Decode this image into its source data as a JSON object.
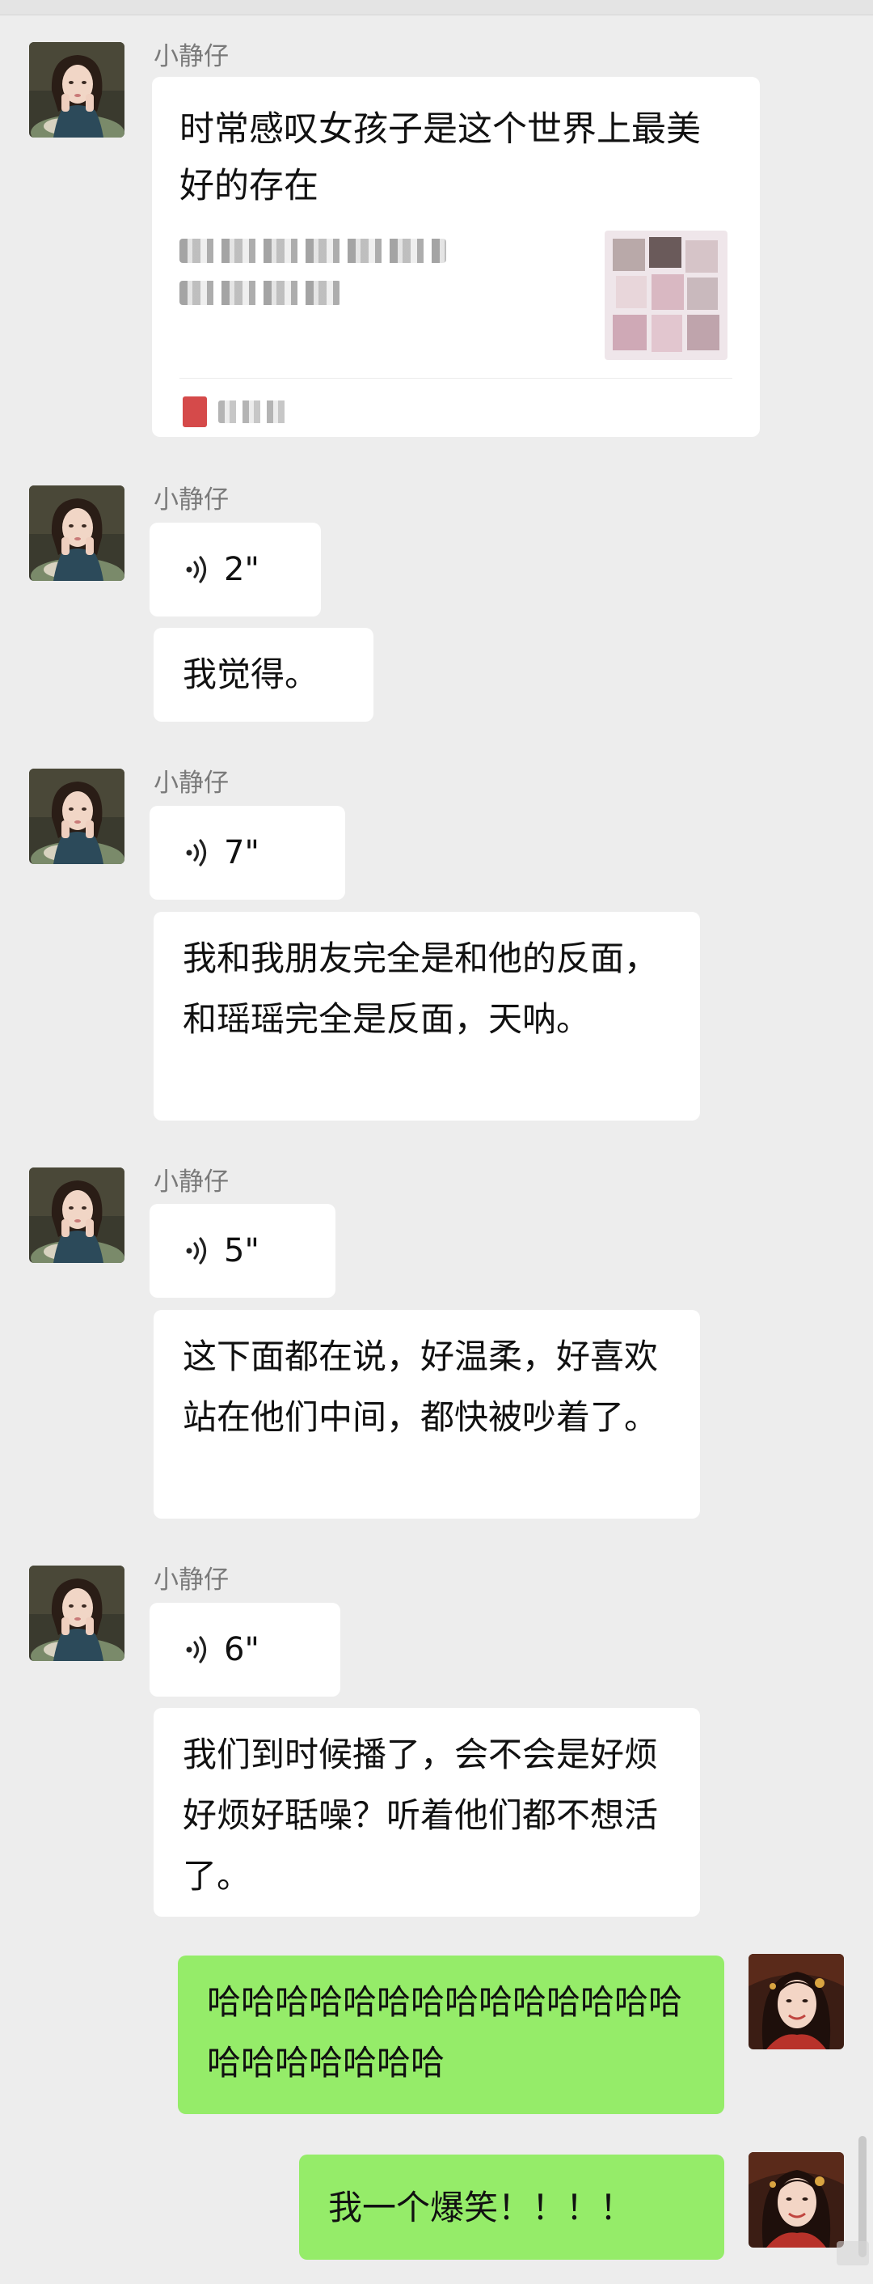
{
  "contact_name": "小静仔",
  "link_card": {
    "title": "时常感叹女孩子是这个世界上最美好的存在"
  },
  "groups": [
    {
      "voice": "2\"",
      "text": "我觉得。"
    },
    {
      "voice": "7\"",
      "text": "我和我朋友完全是和他的反面，和瑶瑶完全是反面，天呐。"
    },
    {
      "voice": "5\"",
      "text": "这下面都在说，好温柔，好喜欢站在他们中间，都快被吵着了。"
    },
    {
      "voice": "6\"",
      "text": "我们到时候播了，会不会是好烦好烦好聒噪？听着他们都不想活了。"
    }
  ],
  "my_messages": [
    "哈哈哈哈哈哈哈哈哈哈哈哈哈哈哈哈哈哈哈哈哈",
    "我一个爆笑！！！！"
  ],
  "colors": {
    "background": "#ededed",
    "incoming_bubble": "#ffffff",
    "outgoing_bubble": "#95ec69"
  },
  "icons": {
    "voice": "voice-wave-icon"
  }
}
